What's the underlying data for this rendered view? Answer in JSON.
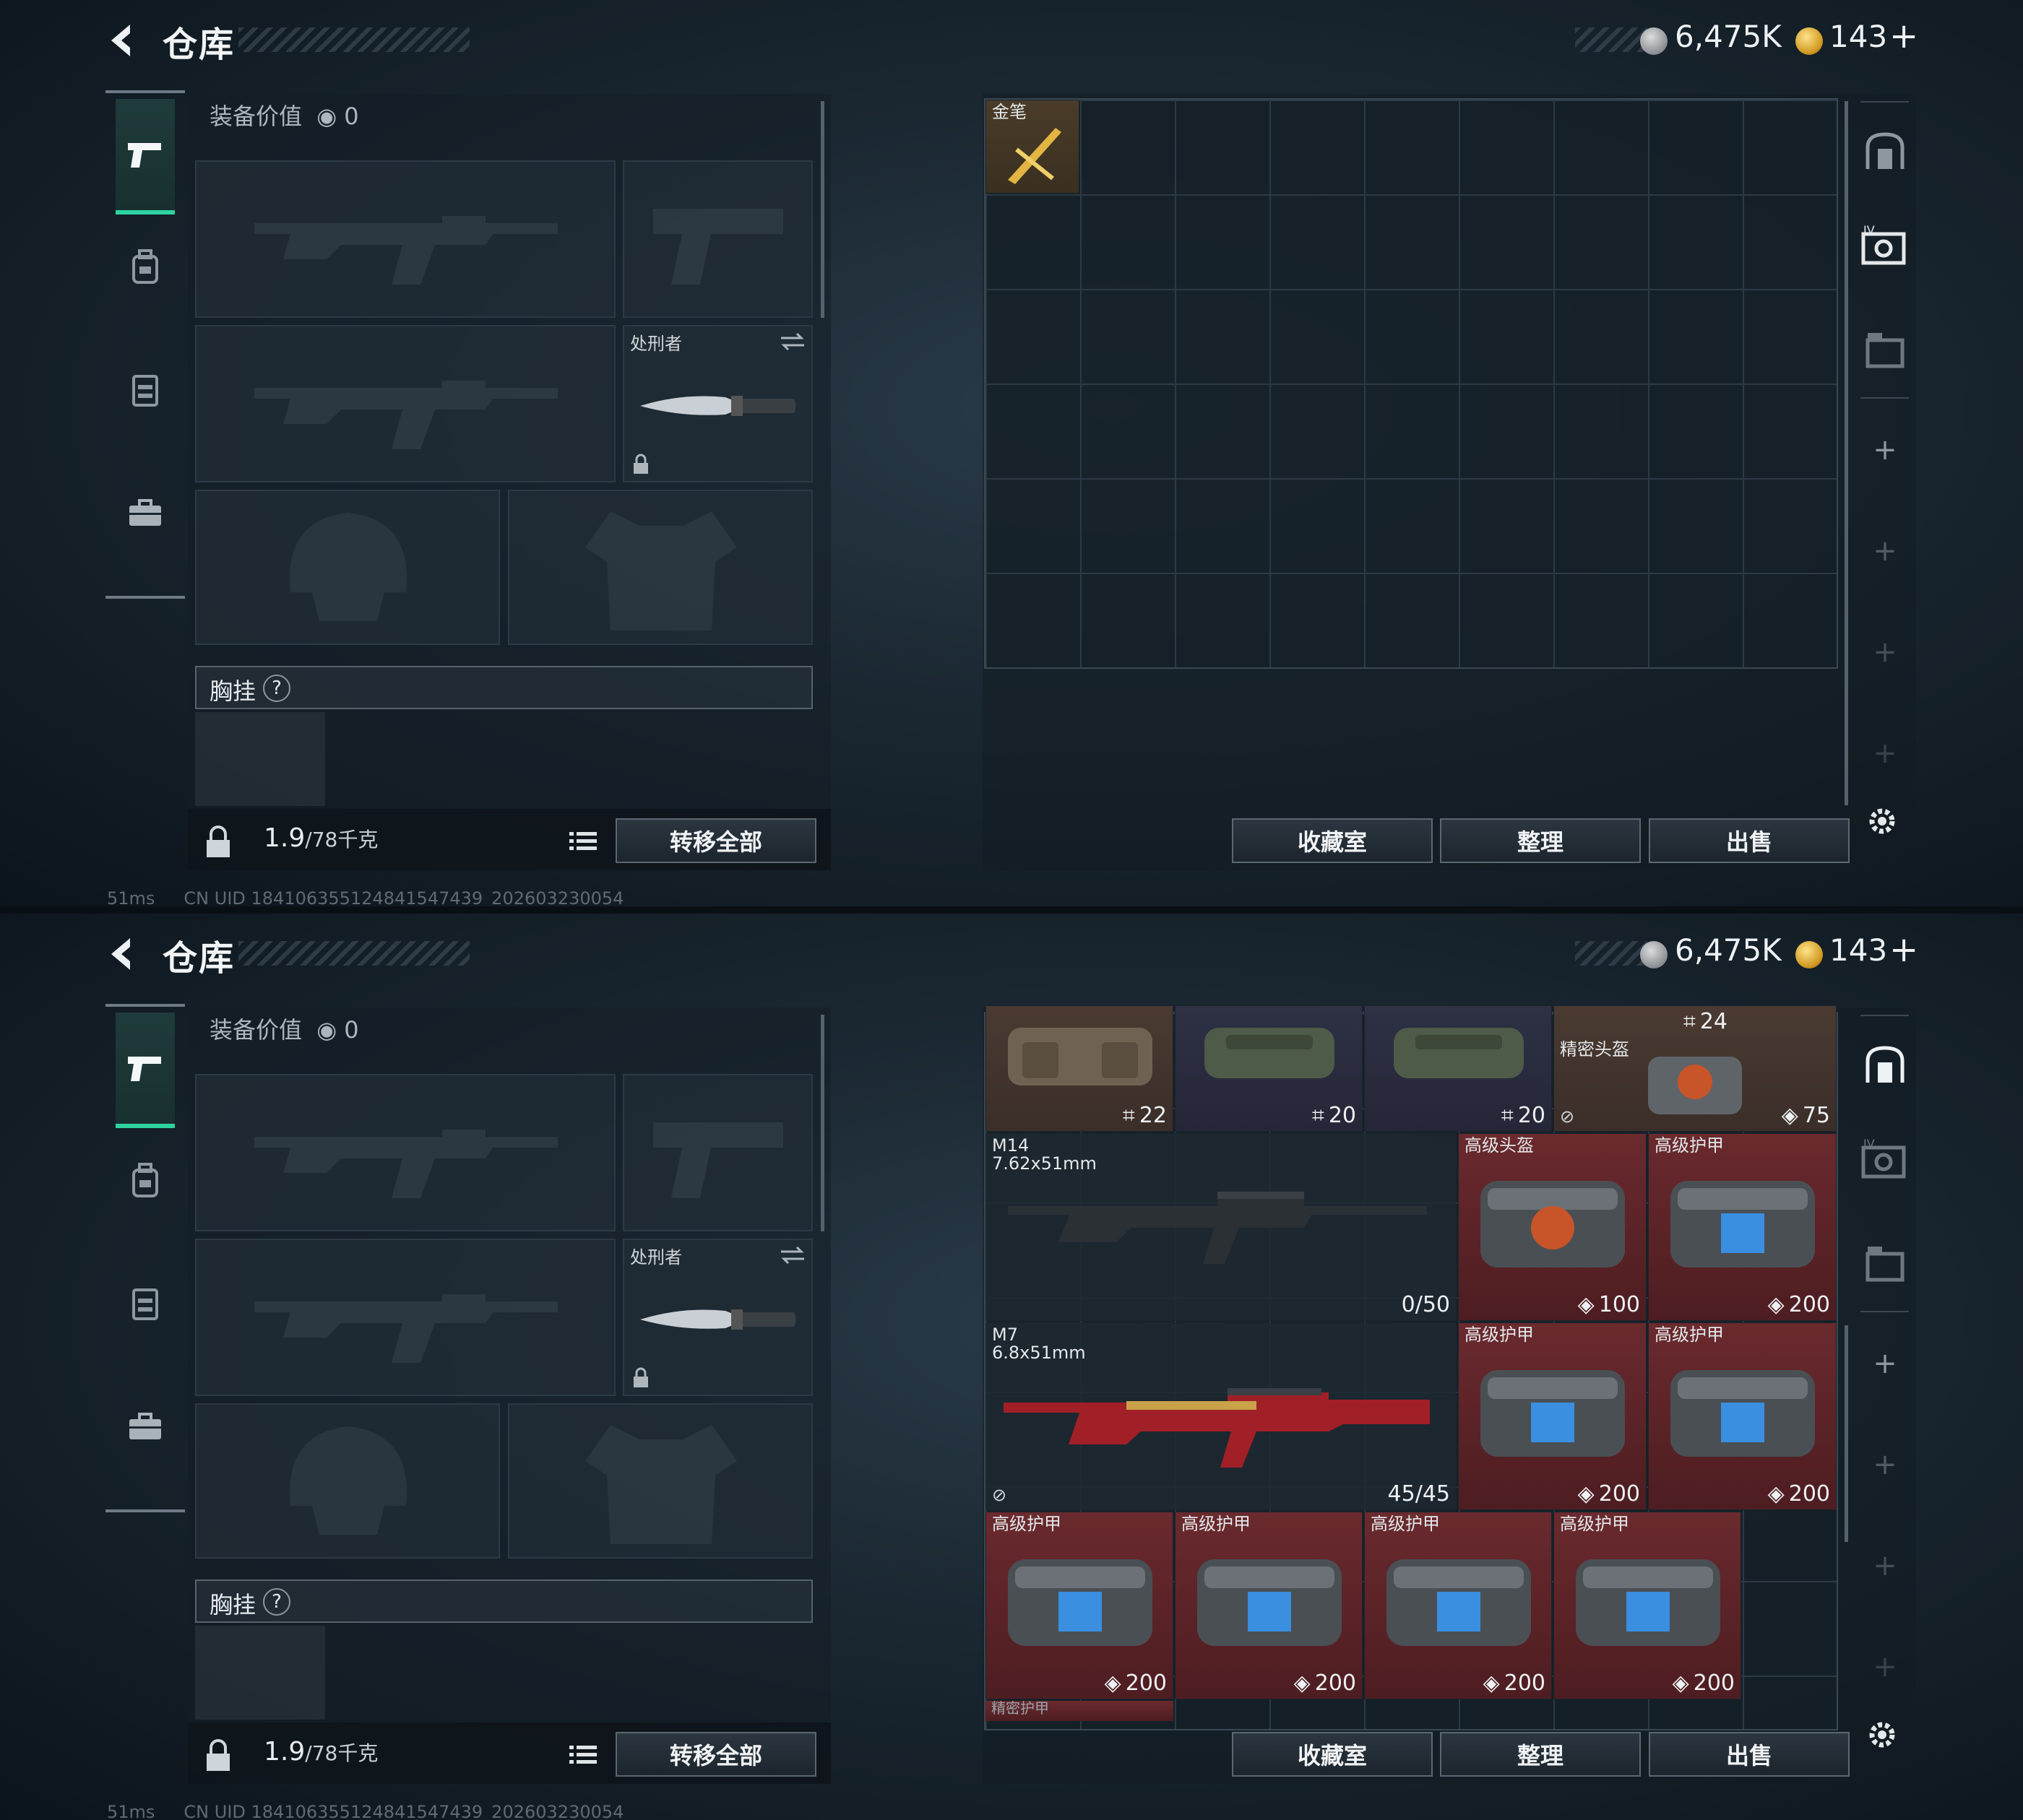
{
  "screens": [
    {
      "header": {
        "title": "仓库",
        "silver_amount": "6,475K",
        "gold_amount": "143"
      },
      "loadout": {
        "equipment_value_label": "装备价值",
        "equipment_value": "0",
        "knife_label": "处刑者",
        "chest_rig_label": "胸挂",
        "weight_value": "1.9",
        "weight_max": "/78千克",
        "transfer_all_label": "转移全部"
      },
      "storage": {
        "gold_pen_label": "金笔"
      },
      "buttons": {
        "collection": "收藏室",
        "sort": "整理",
        "sell": "出售"
      },
      "status": {
        "ping": "51ms",
        "uid": "CN UID 184106355124841547439_202603230054"
      }
    },
    {
      "header": {
        "title": "仓库",
        "silver_amount": "6,475K",
        "gold_amount": "143"
      },
      "loadout": {
        "equipment_value_label": "装备价值",
        "equipment_value": "0",
        "knife_label": "处刑者",
        "chest_rig_label": "胸挂",
        "weight_value": "1.9",
        "weight_max": "/78千克",
        "transfer_all_label": "转移全部"
      },
      "storage": {
        "row1": [
          {
            "count": "22"
          },
          {
            "count": "20"
          },
          {
            "count": "20"
          },
          {
            "label": "精密头盔",
            "top_count": "24",
            "durability": "75"
          }
        ],
        "m14": {
          "name": "M14",
          "caliber": "7.62x51mm",
          "ammo": "0/50"
        },
        "m7": {
          "name": "M7",
          "caliber": "6.8x51mm",
          "ammo": "45/45"
        },
        "armor_items": [
          {
            "label": "高级头盔",
            "value": "100"
          },
          {
            "label": "高级护甲",
            "value": "200"
          },
          {
            "label": "高级护甲",
            "value": "200"
          },
          {
            "label": "高级护甲",
            "value": "200"
          },
          {
            "label": "高级护甲",
            "value": "200"
          },
          {
            "label": "高级护甲",
            "value": "200"
          },
          {
            "label": "高级护甲",
            "value": "200"
          },
          {
            "label": "高级护甲",
            "value": "200"
          }
        ],
        "partial_label": "精密护甲"
      },
      "buttons": {
        "collection": "收藏室",
        "sort": "整理",
        "sell": "出售"
      },
      "status": {
        "ping": "51ms",
        "uid": "CN UID 184106355124841547439_202603230054"
      }
    }
  ],
  "colors": {
    "accent_green": "#2ed3a0",
    "rare_red": "#6a2a2e",
    "panel_dark": "#1c252d"
  },
  "icons": [
    "back-arrow-icon",
    "silver-coin-icon",
    "gold-coin-icon",
    "pistol-icon",
    "backpack-icon",
    "vest-icon",
    "case-icon",
    "lock-icon",
    "list-icon",
    "gear-icon",
    "helmet-icon",
    "safe-icon",
    "crate-icon"
  ]
}
